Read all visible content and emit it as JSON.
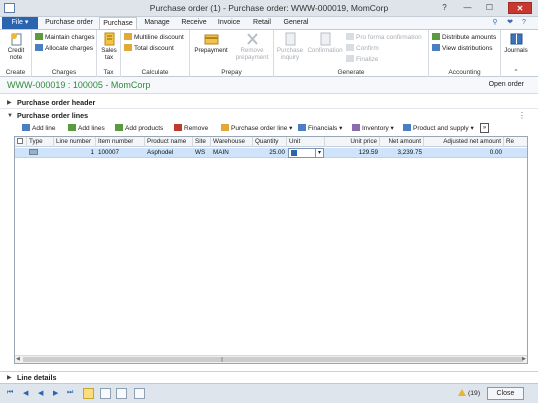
{
  "window": {
    "title": "Purchase order (1) - Purchase order: WWW-000019, MomCorp",
    "minimize": "—",
    "maximize": "☐",
    "close": "✕"
  },
  "ribbon_tabs": [
    {
      "label": "File"
    },
    {
      "label": "Purchase order"
    },
    {
      "label": "Purchase"
    },
    {
      "label": "Manage"
    },
    {
      "label": "Receive"
    },
    {
      "label": "Invoice"
    },
    {
      "label": "Retail"
    },
    {
      "label": "General"
    }
  ],
  "active_tab": "Purchase",
  "ribbon": {
    "create": {
      "label": "Create",
      "credit_note": "Credit note"
    },
    "charges": {
      "label": "Charges",
      "maintain": "Maintain charges",
      "allocate": "Allocate charges"
    },
    "tax": {
      "label": "Tax",
      "sales_tax": "Sales tax"
    },
    "calculate": {
      "label": "Calculate",
      "multiline": "Multiline discount",
      "total": "Total discount"
    },
    "prepay": {
      "label": "Prepay",
      "prepayment": "Prepayment",
      "remove": "Remove prepayment"
    },
    "generate": {
      "label": "Generate",
      "purchase_inquiry": "Purchase inquiry",
      "confirmation": "Confirmation",
      "pro_forma": "Pro forma confirmation",
      "confirm": "Confirm",
      "finalize": "Finalize"
    },
    "accounting": {
      "label": "Accounting",
      "distribute": "Distribute amounts",
      "view_dist": "View distributions"
    },
    "journals": {
      "label": "Journals"
    }
  },
  "record": {
    "title": "WWW-000019 : 100005 - MomCorp",
    "open_order": "Open order"
  },
  "sections": {
    "header": "Purchase order header",
    "lines": "Purchase order lines",
    "line_details": "Line details"
  },
  "grid_toolbar": {
    "add_line": "Add line",
    "add_lines": "Add lines",
    "add_products": "Add products",
    "remove": "Remove",
    "po_line": "Purchase order line",
    "financials": "Financials",
    "inventory": "Inventory",
    "product_supply": "Product and supply",
    "more": "»"
  },
  "grid": {
    "columns": [
      "Type",
      "Line number",
      "Item number",
      "Product name",
      "Site",
      "Warehouse",
      "Quantity",
      "Unit",
      "Unit price",
      "Net amount",
      "Adjusted net amount",
      "Re"
    ],
    "rows": [
      {
        "type": "",
        "line_number": "1",
        "item_number": "100007",
        "product_name": "Asphodel",
        "site": "WS",
        "warehouse": "MAIN",
        "quantity": "25.00",
        "unit": "",
        "unit_price": "129.59",
        "net_amount": "3,239.75",
        "adjusted_net_amount": "0.00"
      }
    ]
  },
  "statusbar": {
    "notifications": "(19)",
    "close": "Close"
  },
  "colors": {
    "accent": "#2a64b1",
    "record_title": "#2e8b3a",
    "selected_row": "#cfe4fb"
  }
}
